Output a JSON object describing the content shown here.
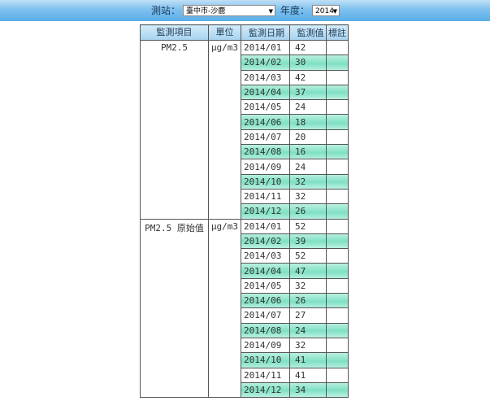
{
  "filters": {
    "station_label": "測站：",
    "station_value": "臺中市-沙鹿",
    "year_label": "年度：",
    "year_value": "2014"
  },
  "table": {
    "headers": [
      "監測項目",
      "單位",
      "監測日期",
      "監測值",
      "標註"
    ],
    "groups": [
      {
        "item": "PM2.5",
        "unit": "μg/m3",
        "rows": [
          {
            "date": "2014/01",
            "value": "42",
            "note": ""
          },
          {
            "date": "2014/02",
            "value": "30",
            "note": ""
          },
          {
            "date": "2014/03",
            "value": "42",
            "note": ""
          },
          {
            "date": "2014/04",
            "value": "37",
            "note": ""
          },
          {
            "date": "2014/05",
            "value": "24",
            "note": ""
          },
          {
            "date": "2014/06",
            "value": "18",
            "note": ""
          },
          {
            "date": "2014/07",
            "value": "20",
            "note": ""
          },
          {
            "date": "2014/08",
            "value": "16",
            "note": ""
          },
          {
            "date": "2014/09",
            "value": "24",
            "note": ""
          },
          {
            "date": "2014/10",
            "value": "32",
            "note": ""
          },
          {
            "date": "2014/11",
            "value": "32",
            "note": ""
          },
          {
            "date": "2014/12",
            "value": "26",
            "note": ""
          }
        ]
      },
      {
        "item": "PM2.5 原始值",
        "unit": "μg/m3",
        "rows": [
          {
            "date": "2014/01",
            "value": "52",
            "note": ""
          },
          {
            "date": "2014/02",
            "value": "39",
            "note": ""
          },
          {
            "date": "2014/03",
            "value": "52",
            "note": ""
          },
          {
            "date": "2014/04",
            "value": "47",
            "note": ""
          },
          {
            "date": "2014/05",
            "value": "32",
            "note": ""
          },
          {
            "date": "2014/06",
            "value": "26",
            "note": ""
          },
          {
            "date": "2014/07",
            "value": "27",
            "note": ""
          },
          {
            "date": "2014/08",
            "value": "24",
            "note": ""
          },
          {
            "date": "2014/09",
            "value": "32",
            "note": ""
          },
          {
            "date": "2014/10",
            "value": "41",
            "note": ""
          },
          {
            "date": "2014/11",
            "value": "41",
            "note": ""
          },
          {
            "date": "2014/12",
            "value": "34",
            "note": ""
          }
        ]
      }
    ]
  },
  "colors": {
    "header_bar": "#7ec0ee",
    "alt_row": "#7fe0c4",
    "table_header": "#a6d2ef"
  }
}
